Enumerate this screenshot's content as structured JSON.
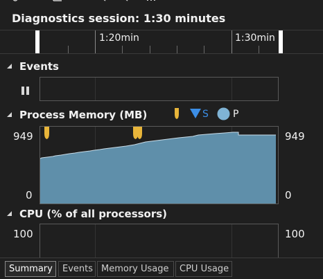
{
  "session": {
    "title": "Diagnostics session: 1:30 minutes"
  },
  "ruler": {
    "label_1": "1:20min",
    "label_2": "1:30min"
  },
  "events": {
    "header": "Events"
  },
  "memory": {
    "header": "Process Memory (MB)",
    "legend_s": "S",
    "legend_p": "P",
    "y_max": "949",
    "y_min": "0",
    "colors": {
      "fill": "#5f8faa",
      "line": "#c8dce8",
      "gc_marker": "#e8b53a",
      "snapshot_marker": "#3c8ee6",
      "p_marker": "#7fb3d5"
    }
  },
  "cpu": {
    "header": "CPU (% of all processors)",
    "y_max": "100"
  },
  "tabs": [
    {
      "label": "Summary",
      "active": true
    },
    {
      "label": "Events",
      "active": false
    },
    {
      "label": "Memory Usage",
      "active": false
    },
    {
      "label": "CPU Usage",
      "active": false
    }
  ]
}
